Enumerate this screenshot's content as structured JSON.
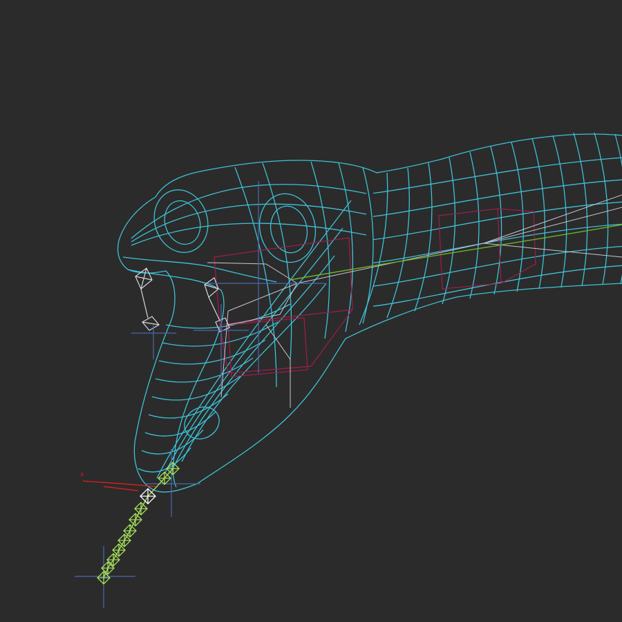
{
  "viewport": {
    "background": "#2b2b2b",
    "render_mode": "wireframe",
    "subject": "snake-head-mesh-with-forked-tongue-rig"
  },
  "colors": {
    "mesh_wire": "#3ec3d8",
    "bone_box": "#a01e4a",
    "ik_line": "#c9c9d4",
    "spine_guide": "#6fb52a",
    "tongue_joint": "#a6e05a",
    "tongue_joint_selected": "#ffffff",
    "helper_crosshair": "#4a6ab0",
    "x_axis": "#d02020"
  },
  "gizmo": {
    "axis_label": "x"
  },
  "icons": {
    "crosshair": "crosshair-icon",
    "joint": "joint-icon"
  }
}
